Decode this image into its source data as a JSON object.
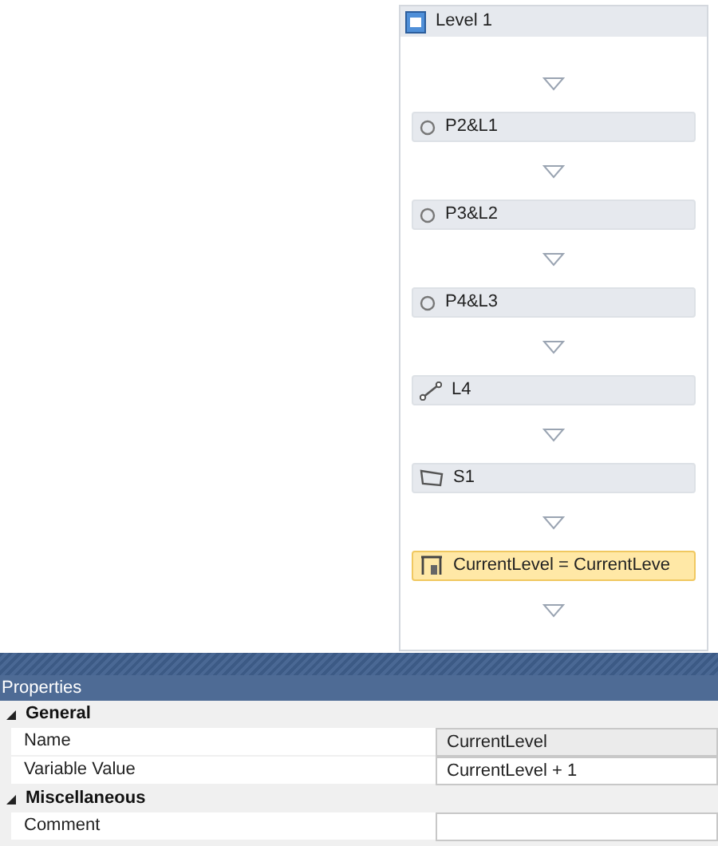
{
  "sequence": {
    "title": "Level 1",
    "activities": [
      {
        "kind": "circle",
        "label": "P2&L1",
        "selected": false
      },
      {
        "kind": "circle",
        "label": "P3&L2",
        "selected": false
      },
      {
        "kind": "circle",
        "label": "P4&L3",
        "selected": false
      },
      {
        "kind": "line",
        "label": "L4",
        "selected": false
      },
      {
        "kind": "shape",
        "label": "S1",
        "selected": false
      },
      {
        "kind": "assign",
        "label": "CurrentLevel = CurrentLeve",
        "selected": true
      }
    ]
  },
  "properties": {
    "title": "Properties",
    "categories": [
      {
        "name": "General",
        "expanded": true,
        "rows": [
          {
            "name": "Name",
            "value": "CurrentLevel",
            "readonly": true
          },
          {
            "name": "Variable Value",
            "value": "CurrentLevel + 1",
            "readonly": false
          }
        ]
      },
      {
        "name": "Miscellaneous",
        "expanded": true,
        "rows": [
          {
            "name": "Comment",
            "readonly": false
          }
        ]
      }
    ]
  }
}
